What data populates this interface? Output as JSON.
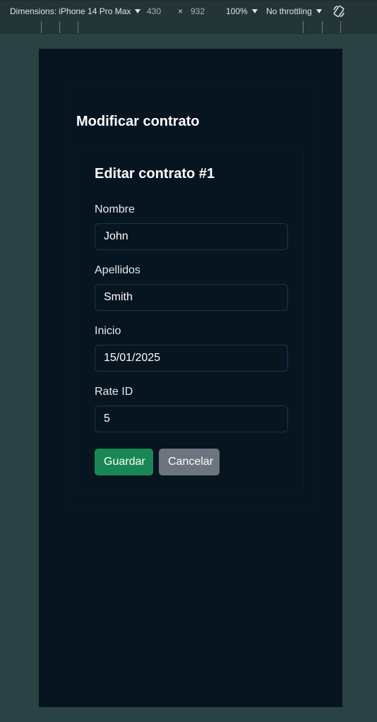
{
  "devtools": {
    "device_label": "Dimensions: iPhone 14 Pro Max",
    "width": "430",
    "times": "×",
    "height": "932",
    "zoom": "100%",
    "throttling": "No throttling"
  },
  "page": {
    "title": "Modificar contrato"
  },
  "form": {
    "title": "Editar contrato #1",
    "fields": [
      {
        "label": "Nombre",
        "value": "John"
      },
      {
        "label": "Apellidos",
        "value": "Smith"
      },
      {
        "label": "Inicio",
        "value": "15/01/2025"
      },
      {
        "label": "Rate ID",
        "value": "5"
      }
    ],
    "save_label": "Guardar",
    "cancel_label": "Cancelar"
  },
  "colors": {
    "save_button": "#198754",
    "cancel_button": "#6c757d",
    "viewport_bg": "#071520",
    "outer_bg": "#2b4244"
  }
}
